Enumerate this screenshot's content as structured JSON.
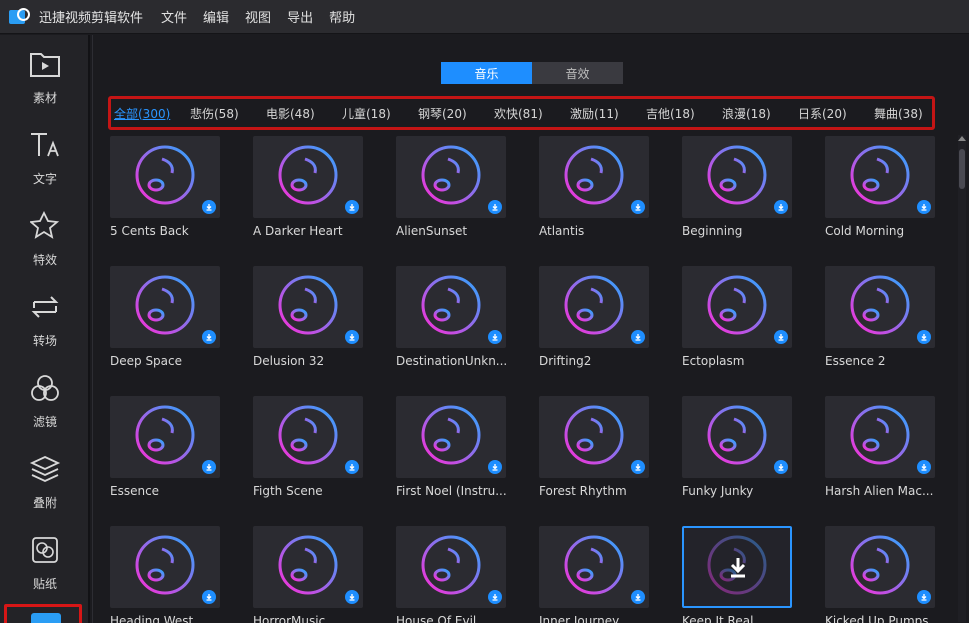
{
  "app": {
    "title": "迅捷视频剪辑软件"
  },
  "menu": [
    "文件",
    "编辑",
    "视图",
    "导出",
    "帮助"
  ],
  "sidebar": [
    {
      "label": "素材",
      "icon": "media-folder-icon"
    },
    {
      "label": "文字",
      "icon": "text-icon"
    },
    {
      "label": "特效",
      "icon": "effects-star-icon"
    },
    {
      "label": "转场",
      "icon": "transition-icon"
    },
    {
      "label": "滤镜",
      "icon": "filter-icon"
    },
    {
      "label": "叠附",
      "icon": "overlay-layers-icon"
    },
    {
      "label": "贴纸",
      "icon": "sticker-icon"
    }
  ],
  "tabs": [
    {
      "label": "音乐",
      "active": true
    },
    {
      "label": "音效",
      "active": false
    }
  ],
  "categories": [
    {
      "label": "全部(300)",
      "active": true
    },
    {
      "label": "悲伤(58)"
    },
    {
      "label": "电影(48)"
    },
    {
      "label": "儿童(18)"
    },
    {
      "label": "钢琴(20)"
    },
    {
      "label": "欢快(81)"
    },
    {
      "label": "激励(11)"
    },
    {
      "label": "吉他(18)"
    },
    {
      "label": "浪漫(18)"
    },
    {
      "label": "日系(20)"
    },
    {
      "label": "舞曲(38)"
    }
  ],
  "music_items": [
    "5 Cents Back",
    "A Darker Heart",
    "AlienSunset",
    "Atlantis",
    "Beginning",
    "Cold Morning",
    "Deep Space",
    "Delusion 32",
    "DestinationUnkn...",
    "Drifting2",
    "Ectoplasm",
    "Essence 2",
    "Essence",
    "Figth Scene",
    "First Noel (Instru...",
    "Forest Rhythm",
    "Funky Junky",
    "Harsh Alien Mac...",
    "Heading West",
    "HorrorMusic",
    "House Of Evil",
    "Inner Journey",
    "Keep It Real",
    "Kicked Up Pumps"
  ],
  "selected_item": "Keep It Real",
  "colors": {
    "accent": "#1e8eff",
    "highlight_border": "#c41515",
    "gradient_start": "#ff2bd6",
    "gradient_end": "#2aa8ff"
  }
}
